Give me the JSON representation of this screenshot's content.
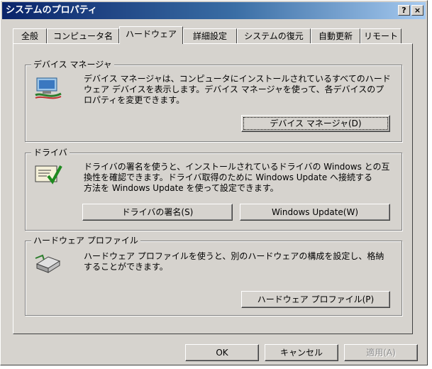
{
  "window": {
    "title": "システムのプロパティ",
    "help_label": "?",
    "close_label": "×"
  },
  "tabs": [
    {
      "label": "全般"
    },
    {
      "label": "コンピュータ名"
    },
    {
      "label": "ハードウェア",
      "active": true
    },
    {
      "label": "詳細設定"
    },
    {
      "label": "システムの復元"
    },
    {
      "label": "自動更新"
    },
    {
      "label": "リモート"
    }
  ],
  "device_manager": {
    "title": "デバイス マネージャ",
    "icon": "device-manager-icon",
    "description_lines": [
      "デバイス マネージャは、コンピュータにインストールされているすべてのハード",
      "ウェア デバイスを表示します。デバイス マネージャを使って、各デバイスのプ",
      "ロパティを変更できます。"
    ],
    "button_label": "デバイス マネージャ(D)"
  },
  "drivers": {
    "title": "ドライバ",
    "icon": "driver-signing-icon",
    "description_lines": [
      "ドライバの署名を使うと、インストールされているドライバの Windows との互",
      "換性を確認できます。ドライバ取得のために Windows Update へ接続する",
      "方法を Windows Update を使って設定できます。"
    ],
    "signing_button_label": "ドライバの署名(S)",
    "update_button_label": "Windows Update(W)"
  },
  "hardware_profiles": {
    "title": "ハードウェア プロファイル",
    "icon": "hardware-profile-icon",
    "description_lines": [
      "ハードウェア プロファイルを使うと、別のハードウェアの構成を設定し、格納",
      "することができます。"
    ],
    "button_label": "ハードウェア プロファイル(P)"
  },
  "footer": {
    "ok_label": "OK",
    "cancel_label": "キャンセル",
    "apply_label": "適用(A)"
  }
}
